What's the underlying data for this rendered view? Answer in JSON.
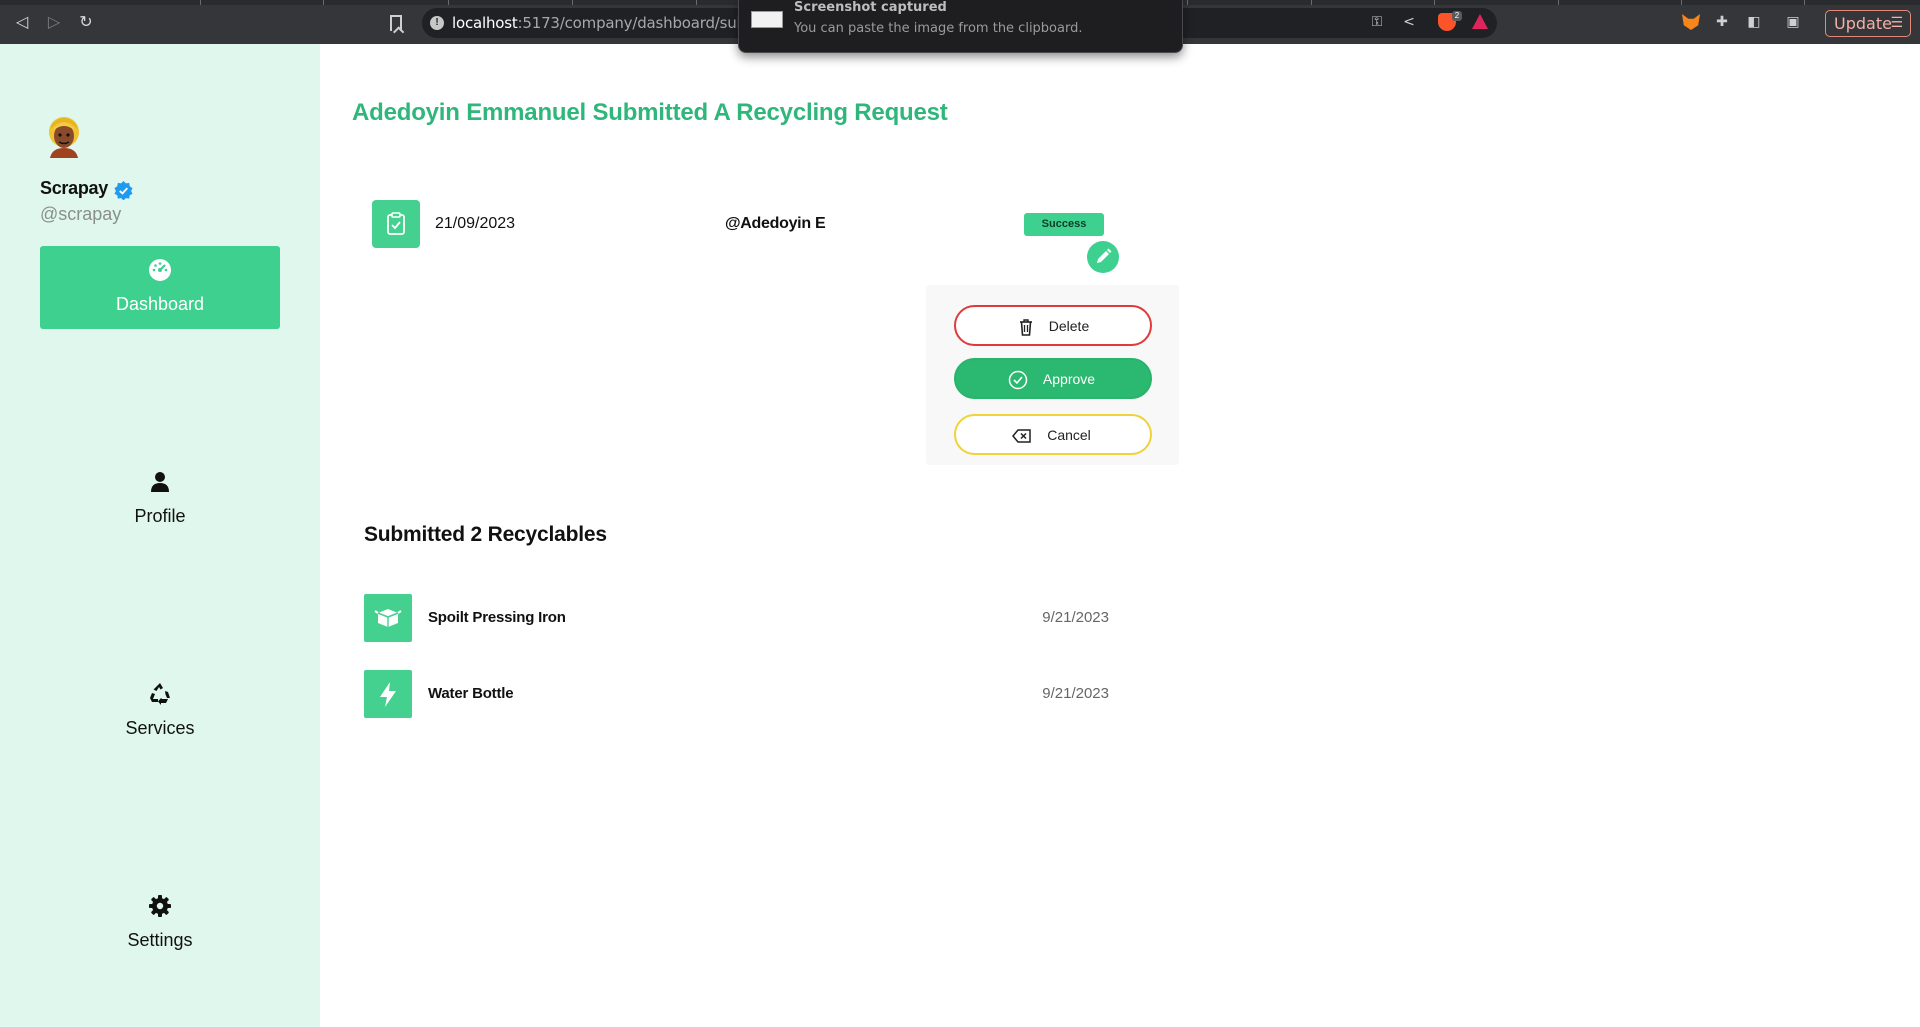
{
  "browser": {
    "url_host": "localhost",
    "url_path": ":5173/company/dashboard/submissi",
    "update_label": "Update",
    "brave_badge": "2"
  },
  "toast": {
    "title": "Screenshot captured",
    "message": "You can paste the image from the clipboard."
  },
  "sidebar": {
    "brand_name": "Scrapay",
    "brand_handle": "@scrapay",
    "items": [
      {
        "label": "Dashboard",
        "icon": "gauge-icon",
        "active": true
      },
      {
        "label": "Profile",
        "icon": "user-icon",
        "active": false
      },
      {
        "label": "Services",
        "icon": "recycle-icon",
        "active": false
      },
      {
        "label": "Settings",
        "icon": "gear-icon",
        "active": false
      }
    ]
  },
  "main": {
    "title": "Adedoyin Emmanuel Submitted A Recycling Request",
    "request": {
      "date": "21/09/2023",
      "user": "@Adedoyin E",
      "status": "Success"
    },
    "actions": {
      "delete": "Delete",
      "approve": "Approve",
      "cancel": "Cancel"
    },
    "section_title": "Submitted 2 Recyclables",
    "items": [
      {
        "name": "Spoilt Pressing Iron",
        "date": "9/21/2023",
        "icon": "box-icon"
      },
      {
        "name": "Water Bottle",
        "date": "9/21/2023",
        "icon": "bolt-icon"
      }
    ]
  },
  "colors": {
    "accent": "#3dd08f",
    "title_green": "#2fb67a",
    "sidebar_bg": "#dff7ec",
    "delete_red": "#e03b3b",
    "cancel_yellow": "#f0d23a"
  }
}
